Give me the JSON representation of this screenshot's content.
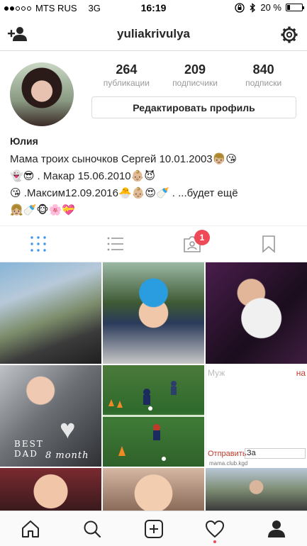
{
  "status_bar": {
    "carrier": "MTS RUS",
    "network": "3G",
    "time": "16:19",
    "battery": "20 %",
    "battery_level": 0.2
  },
  "header": {
    "username": "yuliakrivulya",
    "add_user_icon": "add-user-icon",
    "settings_icon": "gear-icon"
  },
  "profile": {
    "stats": [
      {
        "count": "264",
        "label": "публикации"
      },
      {
        "count": "209",
        "label": "подписчики"
      },
      {
        "count": "840",
        "label": "подписки"
      }
    ],
    "edit_button": "Редактировать профиль",
    "name": "Юлия",
    "bio": "Мама троих сыночков Сергей 10.01.2003👦🏼😘\n👻😎 . Макар 15.06.2010👶🏼😈\n😘 .Максим12.09.2016🐣👶🏼😍🍼 . ...будет ещё\n👧🏼🍼🐵🌸💝"
  },
  "tabs": {
    "items": [
      "grid-view",
      "list-view",
      "tagged-photos",
      "saved"
    ],
    "tagged_badge": "1",
    "accent": "#3897f0"
  },
  "grid": {
    "cell4_text_line1": "BEST",
    "cell4_text_line2": "DAD",
    "cell4_caption": "8 month",
    "cell6_placeholder": "Муж",
    "cell6_right": "на",
    "cell6_send": "Отправить",
    "cell6_input": "За",
    "cell6_site": "mama.club.kgd"
  },
  "bottom_nav": {
    "items": [
      "home-icon",
      "search-icon",
      "add-post-icon",
      "activity-icon",
      "profile-icon"
    ],
    "notification_color": "#ed4956"
  }
}
